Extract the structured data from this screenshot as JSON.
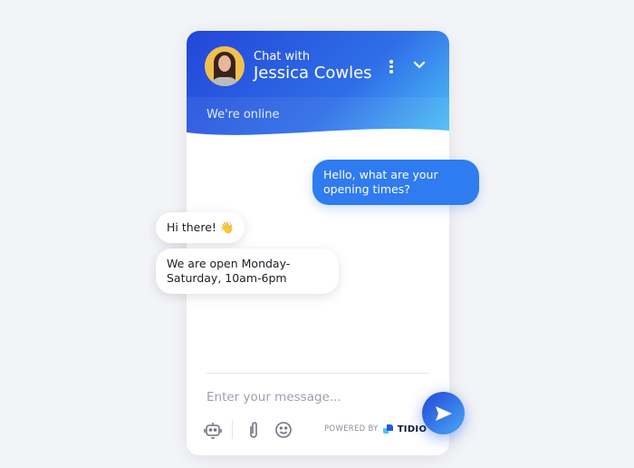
{
  "header": {
    "chat_with": "Chat with",
    "agent_name": "Jessica Cowles",
    "status": "We're online"
  },
  "messages": [
    {
      "from": "user",
      "text": "Hello, what are your opening times?"
    },
    {
      "from": "agent",
      "text": "Hi there! 👋"
    },
    {
      "from": "agent",
      "text": "We are open Monday-Saturday, 10am-6pm"
    }
  ],
  "composer": {
    "placeholder": "Enter your message...",
    "powered_by": "POWERED BY",
    "brand": "TIDIO"
  },
  "icons": [
    "more-vertical-icon",
    "chevron-down-icon",
    "bot-icon",
    "paperclip-icon",
    "emoji-icon",
    "send-icon"
  ],
  "colors": {
    "accent": "#2f7bf0",
    "header_start": "#2346d8",
    "header_end": "#4fc3f7"
  }
}
